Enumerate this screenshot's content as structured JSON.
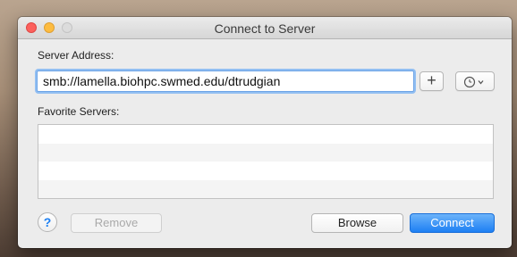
{
  "window": {
    "title": "Connect to Server"
  },
  "server_address": {
    "label": "Server Address:",
    "value": "smb://lamella.biohpc.swmed.edu/dtrudgian",
    "add_icon": "plus-icon",
    "recent_icon": "clock-icon"
  },
  "favorites": {
    "label": "Favorite Servers:",
    "items": []
  },
  "buttons": {
    "help": "?",
    "remove": "Remove",
    "browse": "Browse",
    "connect": "Connect"
  },
  "colors": {
    "accent": "#1d7ff3",
    "close": "#fc615d",
    "minimize": "#fdbc40"
  }
}
